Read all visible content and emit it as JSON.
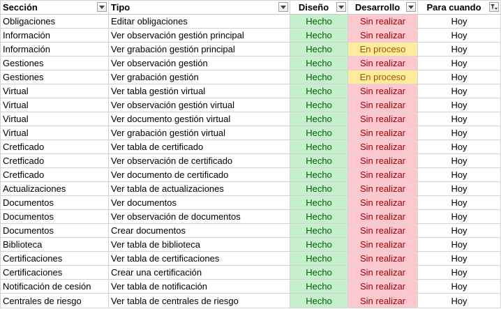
{
  "headers": [
    {
      "label": "Sección",
      "filter_icon": "dropdown-arrow-icon"
    },
    {
      "label": "Tipo",
      "filter_icon": "dropdown-arrow-icon"
    },
    {
      "label": "Diseño",
      "filter_icon": "dropdown-arrow-icon"
    },
    {
      "label": "Desarrollo",
      "filter_icon": "dropdown-arrow-icon"
    },
    {
      "label": "Para cuando",
      "filter_icon": "filter-applied-icon"
    }
  ],
  "colors": {
    "done_bg": "#c6efce",
    "done_text": "#006100",
    "pending_bg": "#ffc7ce",
    "pending_text": "#9c0006",
    "progress_bg": "#ffeb9c",
    "progress_text": "#9c5700"
  },
  "rows": [
    {
      "seccion": "Obligaciones",
      "tipo": "Editar obligaciones",
      "diseno": "Hecho",
      "desarrollo": "Sin realizar",
      "cuando": "Hoy"
    },
    {
      "seccion": "Información",
      "tipo": "Ver observación gestión principal",
      "diseno": "Hecho",
      "desarrollo": "Sin realizar",
      "cuando": "Hoy"
    },
    {
      "seccion": "Información",
      "tipo": "Ver grabación gestión principal",
      "diseno": "Hecho",
      "desarrollo": "En proceso",
      "cuando": "Hoy"
    },
    {
      "seccion": "Gestiones",
      "tipo": "Ver observación gestión",
      "diseno": "Hecho",
      "desarrollo": "Sin realizar",
      "cuando": "Hoy"
    },
    {
      "seccion": "Gestiones",
      "tipo": "Ver grabación gestión",
      "diseno": "Hecho",
      "desarrollo": "En proceso",
      "cuando": "Hoy"
    },
    {
      "seccion": "Virtual",
      "tipo": "Ver tabla gestión virtual",
      "diseno": "Hecho",
      "desarrollo": "Sin realizar",
      "cuando": "Hoy"
    },
    {
      "seccion": "Virtual",
      "tipo": "Ver observación gestión virtual",
      "diseno": "Hecho",
      "desarrollo": "Sin realizar",
      "cuando": "Hoy"
    },
    {
      "seccion": "Virtual",
      "tipo": "Ver documento gestión virtual",
      "diseno": "Hecho",
      "desarrollo": "Sin realizar",
      "cuando": "Hoy"
    },
    {
      "seccion": "Virtual",
      "tipo": "Ver grabación gestión virtual",
      "diseno": "Hecho",
      "desarrollo": "Sin realizar",
      "cuando": "Hoy"
    },
    {
      "seccion": "Cretficado",
      "tipo": "Ver tabla de certificado",
      "diseno": "Hecho",
      "desarrollo": "Sin realizar",
      "cuando": "Hoy"
    },
    {
      "seccion": "Cretficado",
      "tipo": "Ver observación de certificado",
      "diseno": "Hecho",
      "desarrollo": "Sin realizar",
      "cuando": "Hoy"
    },
    {
      "seccion": "Cretficado",
      "tipo": "Ver documento de certificado",
      "diseno": "Hecho",
      "desarrollo": "Sin realizar",
      "cuando": "Hoy"
    },
    {
      "seccion": "Actualizaciones",
      "tipo": "Ver tabla de actualizaciones",
      "diseno": "Hecho",
      "desarrollo": "Sin realizar",
      "cuando": "Hoy"
    },
    {
      "seccion": "Documentos",
      "tipo": "Ver documentos",
      "diseno": "Hecho",
      "desarrollo": "Sin realizar",
      "cuando": "Hoy"
    },
    {
      "seccion": "Documentos",
      "tipo": "Ver observación de documentos",
      "diseno": "Hecho",
      "desarrollo": "Sin realizar",
      "cuando": "Hoy"
    },
    {
      "seccion": "Documentos",
      "tipo": "Crear documentos",
      "diseno": "Hecho",
      "desarrollo": "Sin realizar",
      "cuando": "Hoy"
    },
    {
      "seccion": "Biblioteca",
      "tipo": "Ver tabla de biblioteca",
      "diseno": "Hecho",
      "desarrollo": "Sin realizar",
      "cuando": "Hoy"
    },
    {
      "seccion": "Certificaciones",
      "tipo": "Ver tabla de certificaciones",
      "diseno": "Hecho",
      "desarrollo": "Sin realizar",
      "cuando": "Hoy"
    },
    {
      "seccion": "Certificaciones",
      "tipo": "Crear una certificación",
      "diseno": "Hecho",
      "desarrollo": "Sin realizar",
      "cuando": "Hoy"
    },
    {
      "seccion": "Notificación de cesión",
      "tipo": "Ver tabla de notificación",
      "diseno": "Hecho",
      "desarrollo": "Sin realizar",
      "cuando": "Hoy"
    },
    {
      "seccion": "Centrales de riesgo",
      "tipo": "Ver tabla de centrales de riesgo",
      "diseno": "Hecho",
      "desarrollo": "Sin realizar",
      "cuando": "Hoy"
    }
  ]
}
